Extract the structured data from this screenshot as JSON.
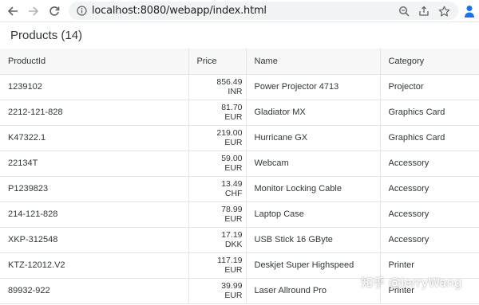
{
  "browser": {
    "url": "localhost:8080/webapp/index.html"
  },
  "page": {
    "title": "Products (14)"
  },
  "table": {
    "columns": [
      "ProductId",
      "Price",
      "Name",
      "Category"
    ],
    "rows": [
      {
        "id": "1239102",
        "price": "856.49",
        "currency": "INR",
        "name": "Power Projector 4713",
        "category": "Projector"
      },
      {
        "id": "2212-121-828",
        "price": "81.70",
        "currency": "EUR",
        "name": "Gladiator MX",
        "category": "Graphics Card"
      },
      {
        "id": "K47322.1",
        "price": "219.00",
        "currency": "EUR",
        "name": "Hurricane GX",
        "category": "Graphics Card"
      },
      {
        "id": "22134T",
        "price": "59.00",
        "currency": "EUR",
        "name": "Webcam",
        "category": "Accessory"
      },
      {
        "id": "P1239823",
        "price": "13.49",
        "currency": "CHF",
        "name": "Monitor Locking Cable",
        "category": "Accessory"
      },
      {
        "id": "214-121-828",
        "price": "78.99",
        "currency": "EUR",
        "name": "Laptop Case",
        "category": "Accessory"
      },
      {
        "id": "XKP-312548",
        "price": "17.19",
        "currency": "DKK",
        "name": "USB Stick 16 GByte",
        "category": "Accessory"
      },
      {
        "id": "KTZ-12012.V2",
        "price": "117.19",
        "currency": "EUR",
        "name": "Deskjet Super Highspeed",
        "category": "Printer"
      },
      {
        "id": "89932-922",
        "price": "39.99",
        "currency": "EUR",
        "name": "Laser Allround Pro",
        "category": "Printer"
      }
    ]
  },
  "watermark": {
    "text": "知乎 @JerryWang"
  }
}
